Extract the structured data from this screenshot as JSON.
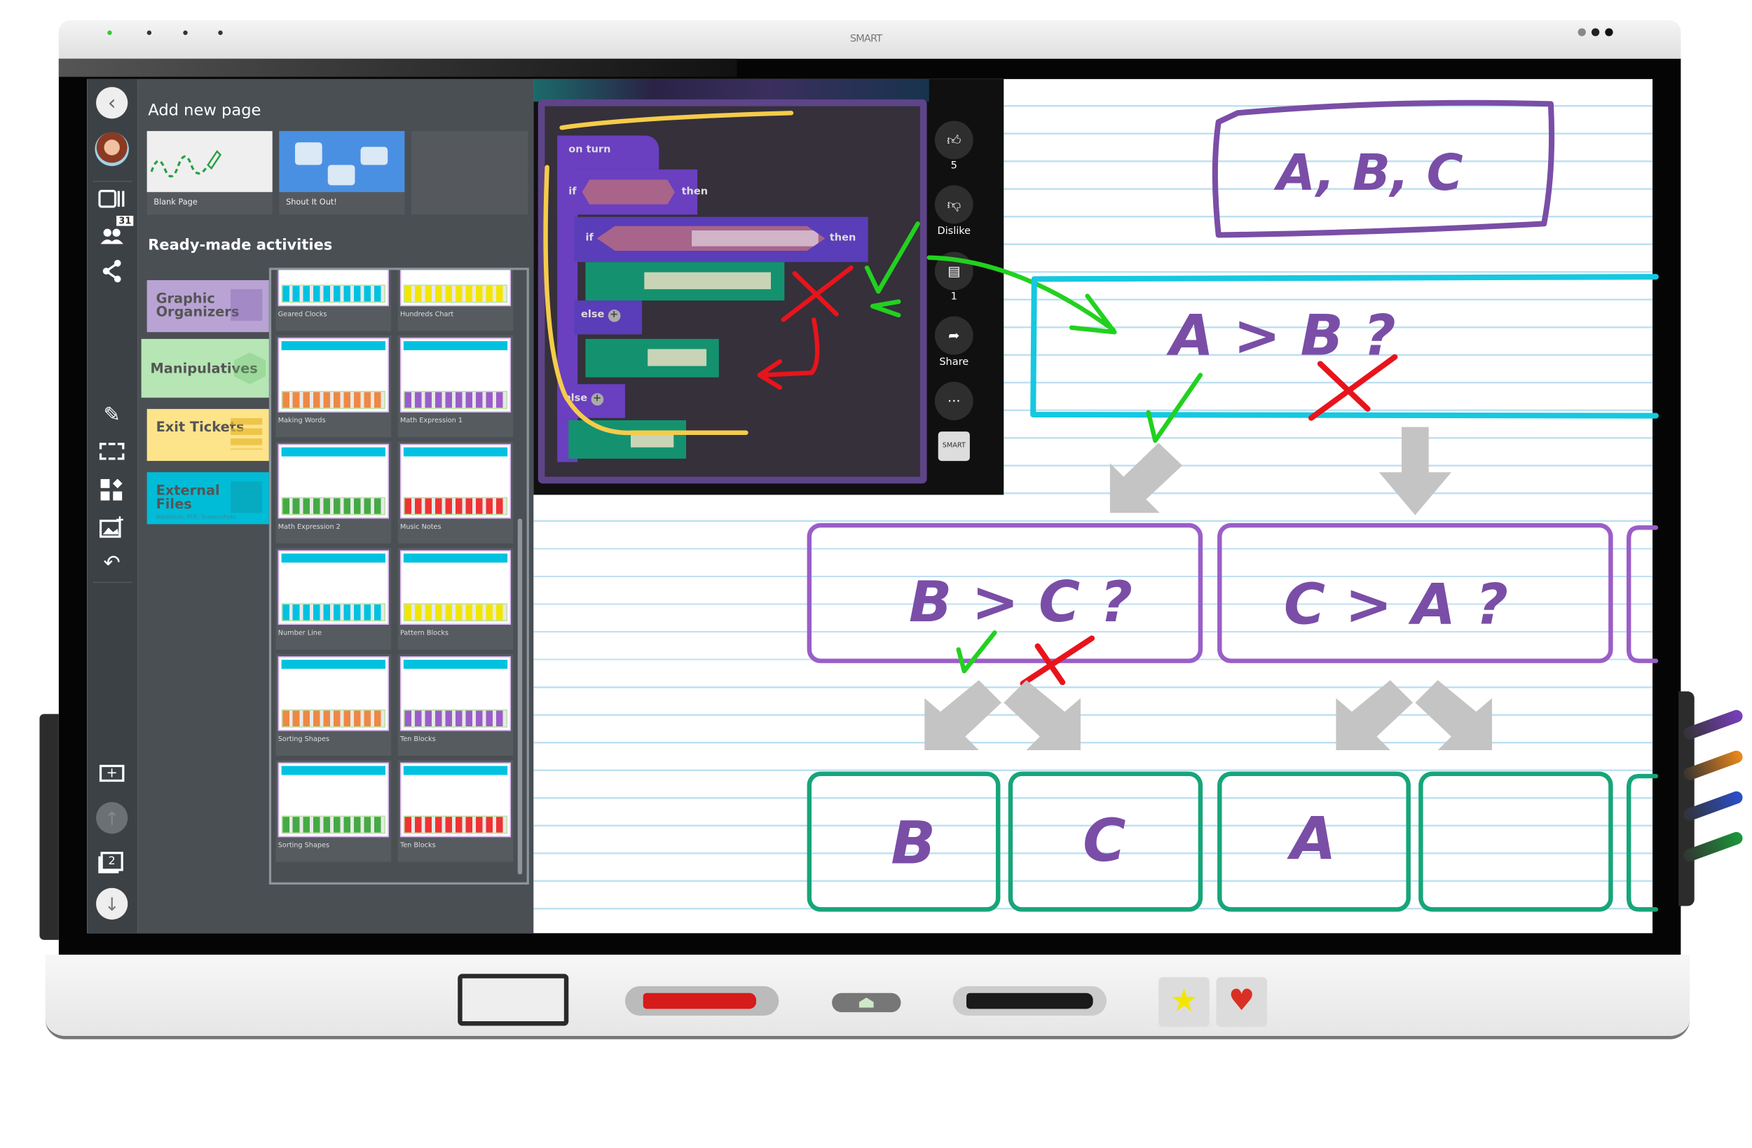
{
  "device": {
    "brand_logo": "SMART"
  },
  "rail": {
    "people_count": "31",
    "page_number": "2"
  },
  "panel": {
    "add_new_page_title": "Add new page",
    "templates": [
      {
        "label": "Blank Page"
      },
      {
        "label": "Shout It Out!"
      }
    ],
    "ready_made_title": "Ready-made activities",
    "categories": [
      {
        "label": "Graphic Organizers",
        "color": "#b9a3d4"
      },
      {
        "label": "Manipulatives",
        "color": "#b5e6b4"
      },
      {
        "label": "Exit Tickets",
        "color": "#fde38a"
      },
      {
        "label": "External Files",
        "sublabel": "Notebook, PDF, Screenshots",
        "color": "#00bcd6"
      }
    ],
    "activities": [
      {
        "label": "Geared Clocks"
      },
      {
        "label": "Hundreds Chart"
      },
      {
        "label": "Making Words"
      },
      {
        "label": "Math Expression 1"
      },
      {
        "label": "Math Expression 2"
      },
      {
        "label": "Music Notes"
      },
      {
        "label": "Number Line"
      },
      {
        "label": "Pattern Blocks"
      },
      {
        "label": "Sorting Shapes"
      },
      {
        "label": "Ten Blocks"
      },
      {
        "label": "Sorting Shapes"
      },
      {
        "label": "Ten Blocks"
      }
    ]
  },
  "video": {
    "blocks": {
      "on_turn": "on turn",
      "if": "if",
      "then": "then",
      "else": "else"
    },
    "likes": "5",
    "dislike_label": "Dislike",
    "comments": "1",
    "share_label": "Share",
    "more": "···",
    "logo": "SMART"
  },
  "whiteboard": {
    "set": "A, B, C",
    "q1": "A > B ?",
    "q2": "B > C ?",
    "q3": "C > A ?",
    "results": [
      "B",
      "C",
      "A"
    ]
  },
  "colors": {
    "purple_ink": "#7a4ea6",
    "cyan_ink": "#16c8e0",
    "green_box": "#17a57a",
    "check": "#22d11f",
    "cross": "#e8141c"
  }
}
